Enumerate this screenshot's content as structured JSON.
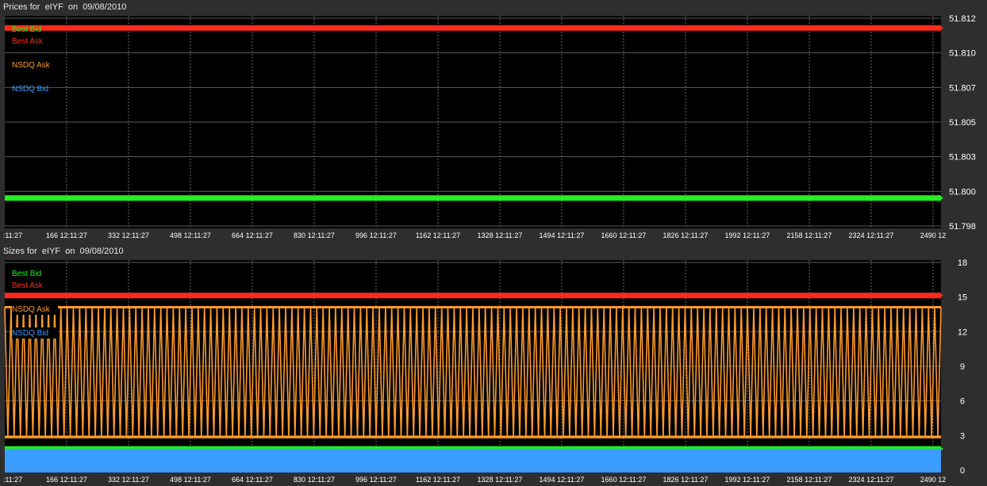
{
  "panels": [
    {
      "title": "Prices for  eIYF  on  09/08/2010",
      "chart_data": {
        "type": "line",
        "title": "Prices for  eIYF  on  09/08/2010",
        "xlabel": "",
        "ylabel": "",
        "x_tick_labels": [
          ":11:27",
          "166 12:11:27",
          "332 12:11:27",
          "498 12:11:27",
          "664 12:11:27",
          "830 12:11:27",
          "996 12:11:27",
          "1162 12:11:27",
          "1328 12:11:27",
          "1494 12:11:27",
          "1660 12:11:27",
          "1826 12:11:27",
          "1992 12:11:27",
          "2158 12:11:27",
          "2324 12:11:27",
          "2490 12"
        ],
        "x_range": [
          0,
          2520
        ],
        "y_ticks": [
          "51.812",
          "51.810",
          "51.807",
          "51.805",
          "51.803",
          "51.800",
          "51.798"
        ],
        "ylim": [
          51.798,
          51.812
        ],
        "grid": true,
        "legend_position": "top-left",
        "series": [
          {
            "name": "Best Bid",
            "color": "#22ee22",
            "x": [
              0,
              2520
            ],
            "y": [
              51.8,
              51.8
            ]
          },
          {
            "name": "Best Ask",
            "color": "#ff2a1a",
            "x": [
              0,
              2520
            ],
            "y": [
              51.8112,
              51.8112
            ]
          },
          {
            "name": "NSDQ Ask",
            "color": "#ff9a2a",
            "x": [],
            "y": []
          },
          {
            "name": "NSDQ Bid",
            "color": "#3a9dff",
            "x": [],
            "y": []
          }
        ]
      }
    },
    {
      "title": "Sizes for  eIYF  on  09/08/2010",
      "chart_data": {
        "type": "line",
        "title": "Sizes for  eIYF  on  09/08/2010",
        "xlabel": "",
        "ylabel": "",
        "x_tick_labels": [
          ":11:27",
          "166 12:11:27",
          "332 12:11:27",
          "498 12:11:27",
          "664 12:11:27",
          "830 12:11:27",
          "996 12:11:27",
          "1162 12:11:27",
          "1328 12:11:27",
          "1494 12:11:27",
          "1660 12:11:27",
          "1826 12:11:27",
          "1992 12:11:27",
          "2158 12:11:27",
          "2324 12:11:27",
          "2490 12"
        ],
        "x_range": [
          0,
          2520
        ],
        "y_ticks": [
          "18",
          "15",
          "12",
          "9",
          "6",
          "3",
          "0"
        ],
        "ylim": [
          0,
          18
        ],
        "grid": true,
        "legend_position": "top-left",
        "series": [
          {
            "name": "Best Bid",
            "color": "#22ee22",
            "x": [
              0,
              2520
            ],
            "y": [
              2,
              2
            ]
          },
          {
            "name": "Best Ask",
            "color": "#ff2a1a",
            "x": [
              0,
              2520
            ],
            "y": [
              15,
              15
            ]
          },
          {
            "name": "NSDQ Ask",
            "color": "#ff9a2a",
            "x": [
              0,
              2520
            ],
            "y": [
              14,
              14
            ],
            "oscillates_between": [
              3,
              14
            ]
          },
          {
            "name": "NSDQ Bid",
            "color": "#3a9dff",
            "x": [
              0,
              2520
            ],
            "y": [
              2,
              2
            ],
            "filled": true
          }
        ]
      }
    }
  ]
}
